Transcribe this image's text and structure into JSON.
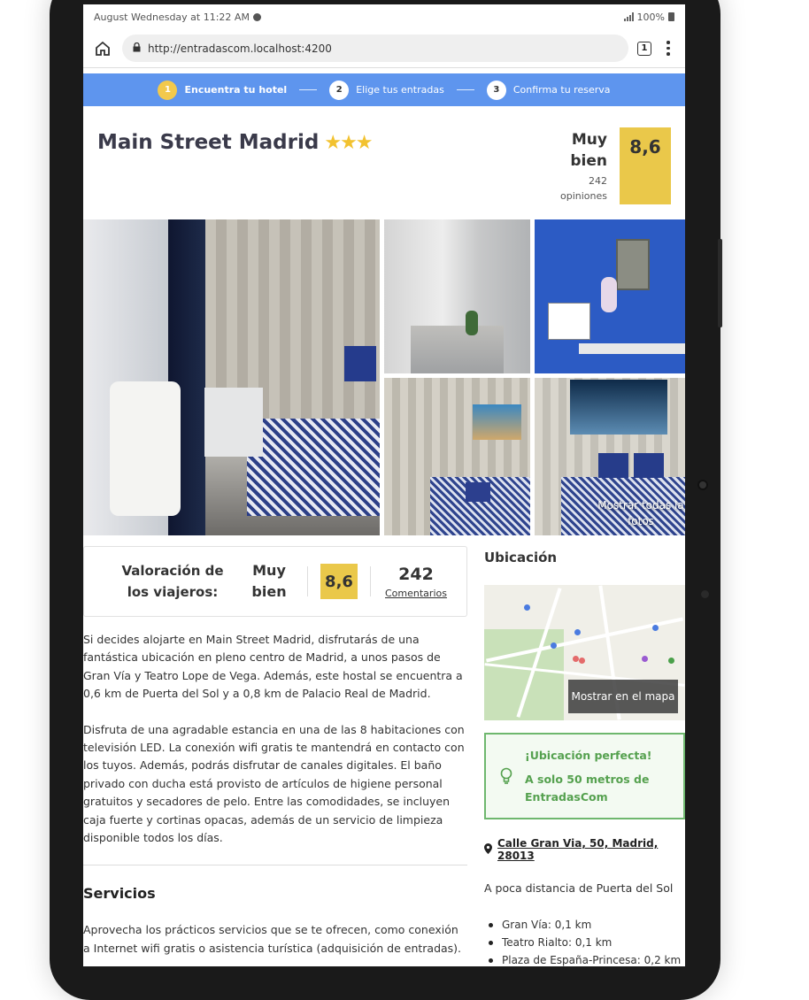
{
  "status_bar": {
    "time": "August Wednesday at 11:22 AM",
    "battery": "100%"
  },
  "browser": {
    "url": "http://entradascom.localhost:4200",
    "tab_count": "1"
  },
  "steps": [
    {
      "num": "1",
      "label": "Encuentra tu hotel"
    },
    {
      "num": "2",
      "label": "Elige tus entradas"
    },
    {
      "num": "3",
      "label": "Confirma tu reserva"
    }
  ],
  "hotel": {
    "name": "Main Street Madrid",
    "stars": "★★★",
    "rating_word_1": "Muy",
    "rating_word_2": "bien",
    "reviews_1": "242",
    "reviews_2": "opiniones",
    "score": "8,6"
  },
  "gallery": {
    "show_all_1": "Mostrar todas la",
    "show_all_2": "fotos"
  },
  "valoracion": {
    "title_1": "Valoración de",
    "title_2": "los viajeros:",
    "word_1": "Muy",
    "word_2": "bien",
    "score": "8,6",
    "count": "242",
    "link": "Comentarios"
  },
  "description": {
    "p1": "Si decides alojarte en Main Street Madrid, disfrutarás de una fantástica ubicación en pleno centro de Madrid, a unos pasos de Gran Vía y Teatro Lope de Vega. Además, este hostal se encuentra a 0,6 km de Puerta del Sol y a 0,8 km de Palacio Real de Madrid.",
    "p2": "Disfruta de una agradable estancia en una de las 8 habitaciones con televisión LED. La conexión wifi gratis te mantendrá en contacto con los tuyos. Además, podrás disfrutar de canales digitales. El baño privado con ducha está provisto de artículos de higiene personal gratuitos y secadores de pelo. Entre las comodidades, se incluyen caja fuerte y cortinas opacas, además de un servicio de limpieza disponible todos los días."
  },
  "servicios": {
    "title": "Servicios",
    "text": "Aprovecha los prácticos servicios que se te ofrecen, como conexión a Internet wifi gratis o asistencia turística (adquisición de entradas)."
  },
  "location": {
    "title": "Ubicación",
    "map_button": "Mostrar en el mapa",
    "perfect_title": "¡Ubicación perfecta!",
    "perfect_text": "A solo 50 metros de EntradasCom",
    "address": "Calle Gran Via, 50, Madrid, 28013",
    "near_title": "A poca distancia de Puerta del Sol",
    "near": [
      "Gran Vía: 0,1 km",
      "Teatro Rialto: 0,1 km",
      "Plaza de España-Princesa: 0,2 km"
    ]
  },
  "colors": {
    "steps_bar": "#5e95ee",
    "score_bg": "#eac84a",
    "star": "#f2c230",
    "perfect_green": "#55a14f"
  }
}
